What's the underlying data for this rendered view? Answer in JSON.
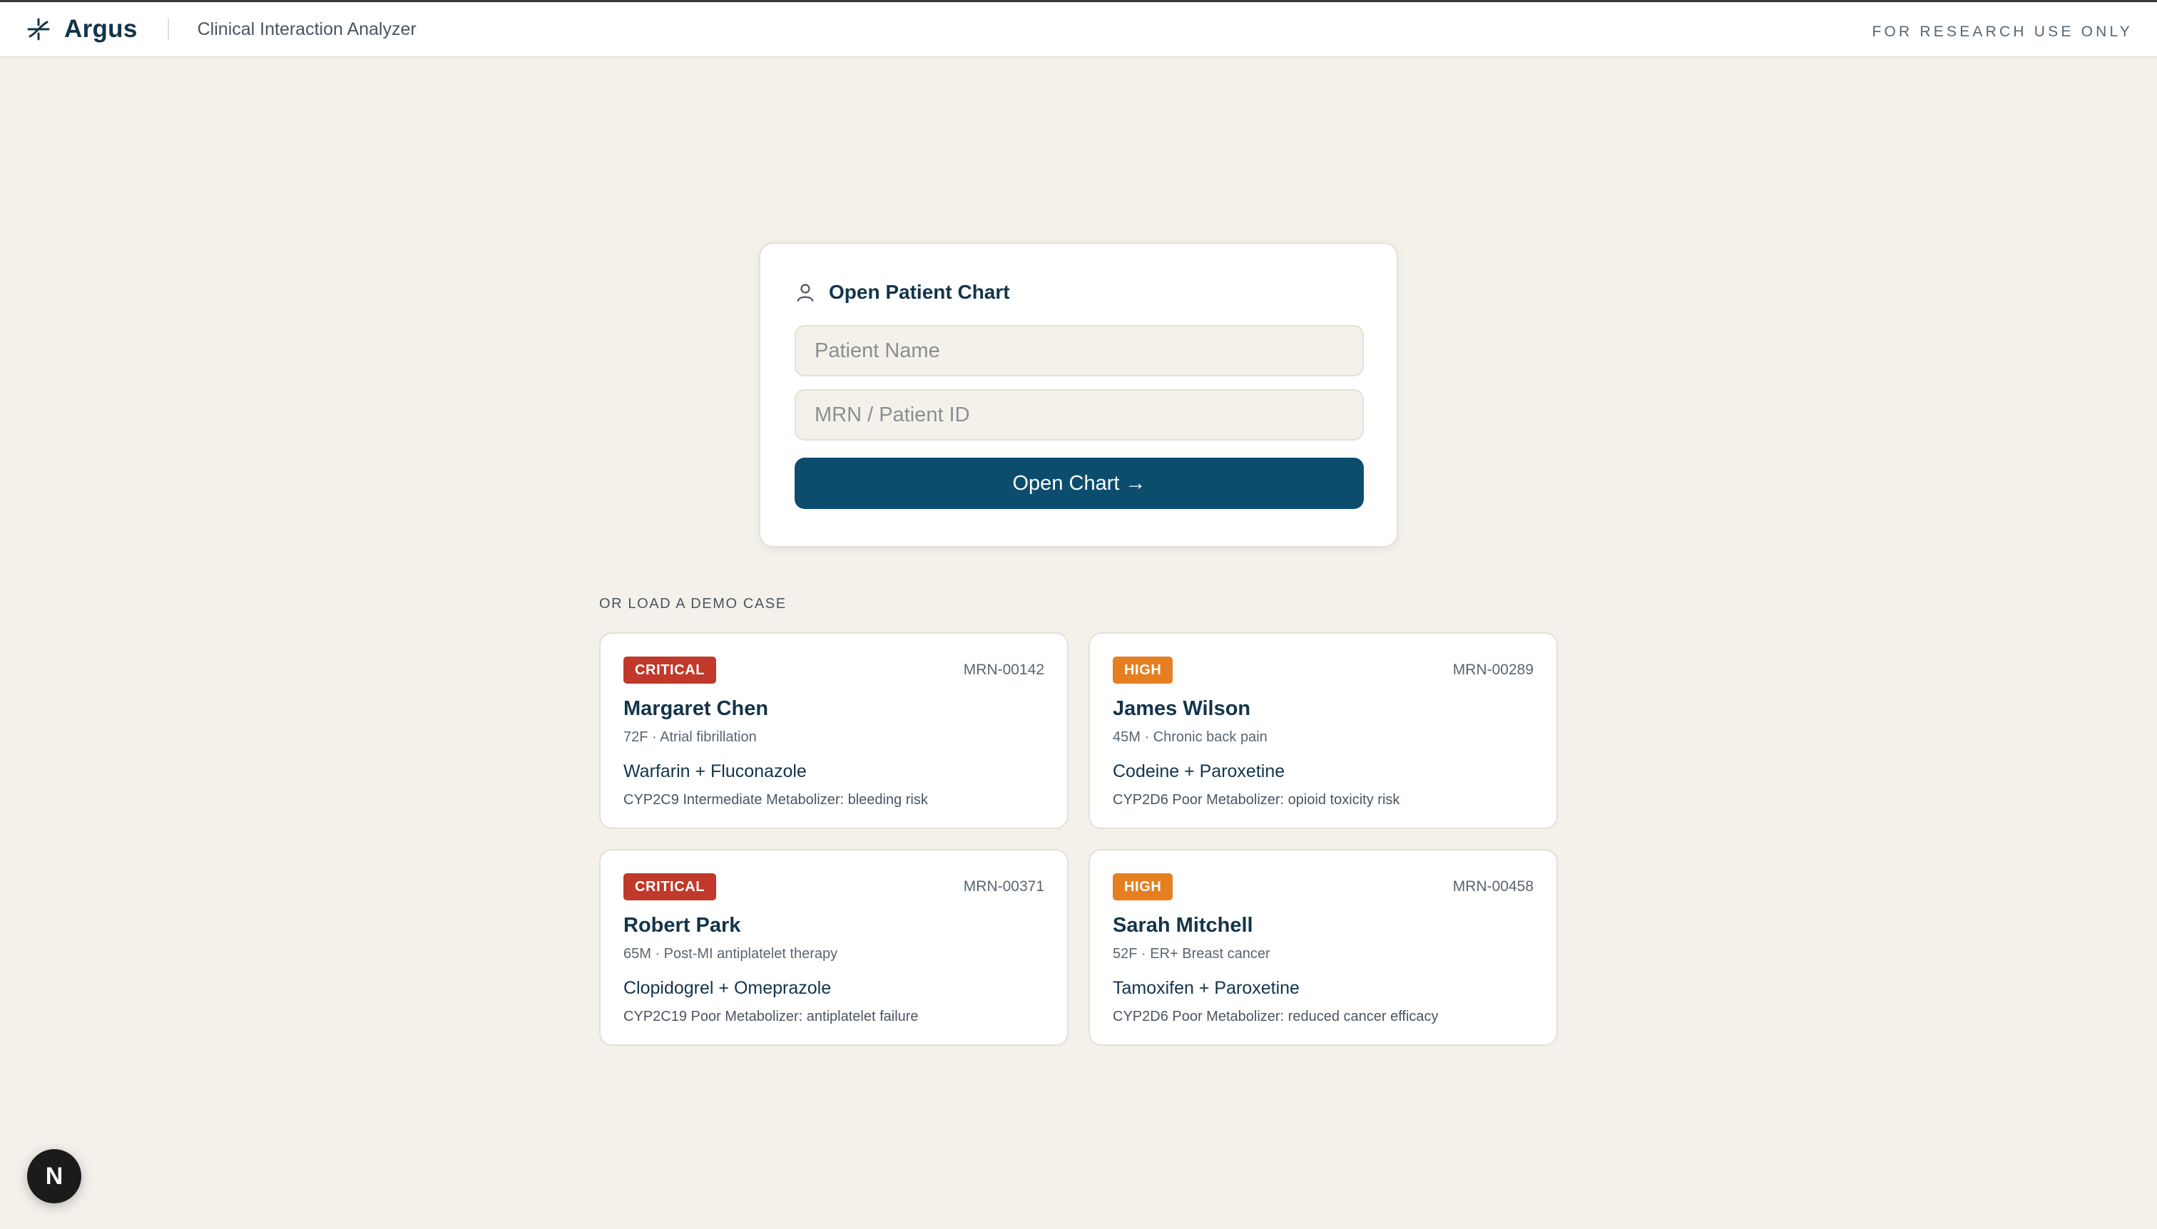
{
  "header": {
    "brand": "Argus",
    "subtitle": "Clinical Interaction Analyzer",
    "notice": "FOR RESEARCH USE ONLY"
  },
  "chart_form": {
    "title": "Open Patient Chart",
    "name_placeholder": "Patient Name",
    "name_value": "",
    "mrn_placeholder": "MRN / Patient ID",
    "mrn_value": "",
    "submit_label": "Open Chart →"
  },
  "demo": {
    "label": "OR LOAD A DEMO CASE",
    "cases": [
      {
        "severity": "CRITICAL",
        "mrn": "MRN-00142",
        "name": "Margaret Chen",
        "info": "72F · Atrial fibrillation",
        "drugs": "Warfarin + Fluconazole",
        "note": "CYP2C9 Intermediate Metabolizer: bleeding risk"
      },
      {
        "severity": "HIGH",
        "mrn": "MRN-00289",
        "name": "James Wilson",
        "info": "45M · Chronic back pain",
        "drugs": "Codeine + Paroxetine",
        "note": "CYP2D6 Poor Metabolizer: opioid toxicity risk"
      },
      {
        "severity": "CRITICAL",
        "mrn": "MRN-00371",
        "name": "Robert Park",
        "info": "65M · Post-MI antiplatelet therapy",
        "drugs": "Clopidogrel + Omeprazole",
        "note": "CYP2C19 Poor Metabolizer: antiplatelet failure"
      },
      {
        "severity": "HIGH",
        "mrn": "MRN-00458",
        "name": "Sarah Mitchell",
        "info": "52F · ER+ Breast cancer",
        "drugs": "Tamoxifen + Paroxetine",
        "note": "CYP2D6 Poor Metabolizer: reduced cancer efficacy"
      }
    ]
  },
  "colors": {
    "critical": "#c0392b",
    "high": "#e67e22",
    "primary": "#0c4d6e"
  },
  "dev_badge": {
    "letter": "N"
  }
}
